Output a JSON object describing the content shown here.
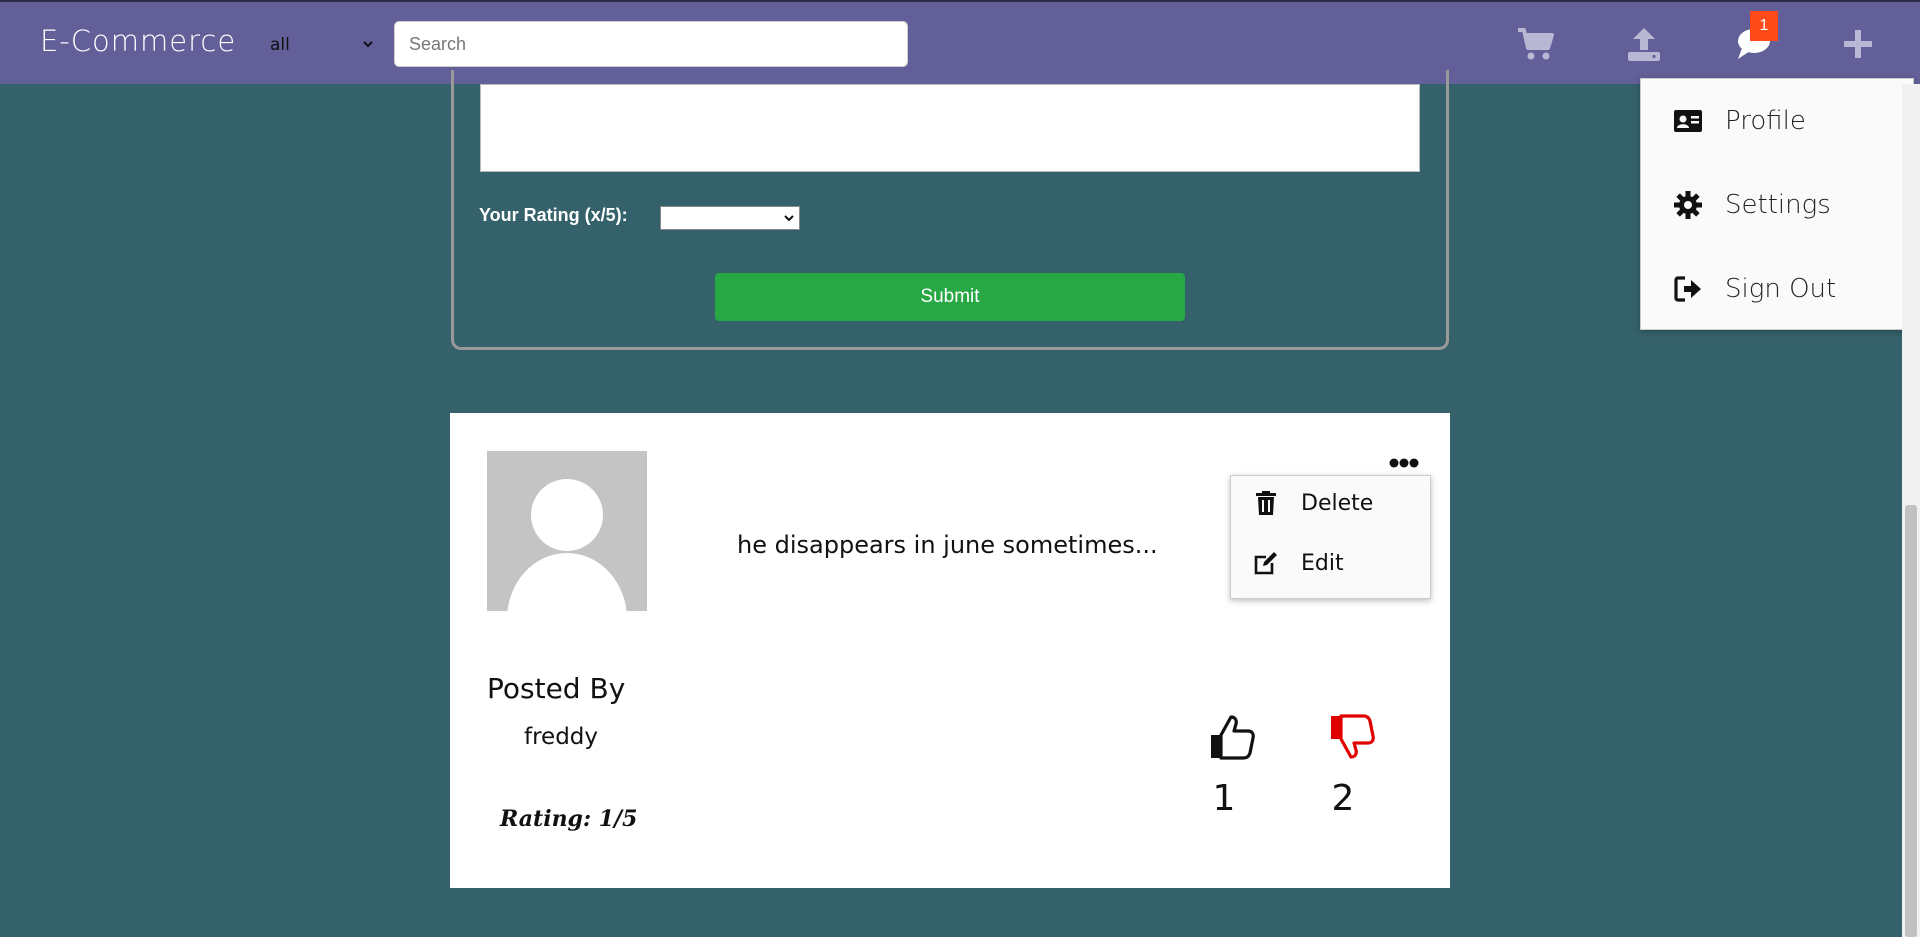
{
  "navbar": {
    "brand": "E-Commerce",
    "category_selected": "all",
    "search_placeholder": "Search",
    "notification_count": "1",
    "icons": [
      "cart-icon",
      "upload-icon",
      "chat-icon",
      "plus-icon"
    ]
  },
  "account_menu": {
    "items": [
      {
        "label": "Profile",
        "icon": "id-card-icon"
      },
      {
        "label": "Settings",
        "icon": "gear-icon"
      },
      {
        "label": "Sign Out",
        "icon": "sign-out-icon"
      }
    ]
  },
  "review_form": {
    "rating_label": "Your Rating (x/5):",
    "rating_selected": "",
    "submit_label": "Submit"
  },
  "comment": {
    "text": "he disappears in june sometimes...",
    "posted_by_label": "Posted By",
    "username": "freddy",
    "rating": "Rating: 1/5",
    "likes": "1",
    "dislikes": "2",
    "menu": [
      {
        "label": "Delete",
        "icon": "trash-icon"
      },
      {
        "label": "Edit",
        "icon": "edit-icon"
      }
    ]
  },
  "colors": {
    "navbar": "#625f99",
    "background": "#35616b",
    "submit": "#28a745",
    "badge": "#ff4a1a",
    "dislike": "#e00000"
  }
}
